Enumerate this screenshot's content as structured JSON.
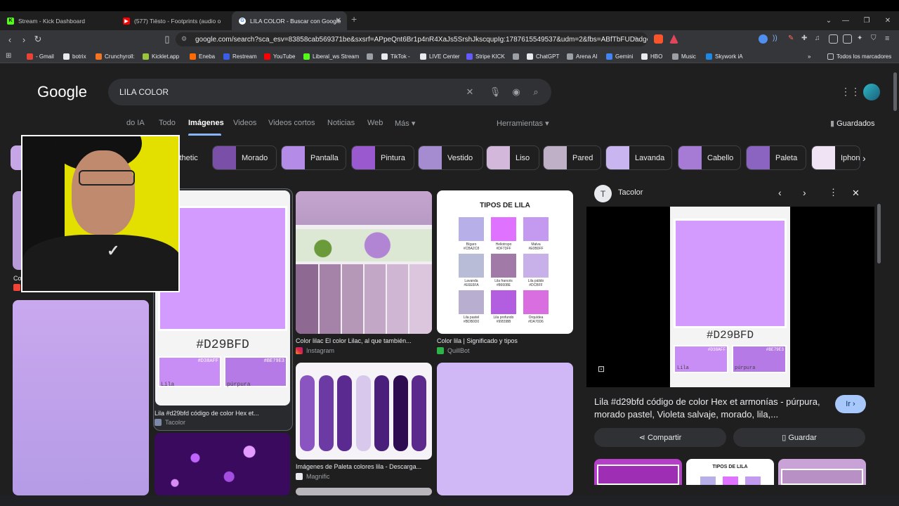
{
  "tabs": [
    {
      "title": "Stream - Kick Dashboard",
      "icon": "kick-icon",
      "color": "#53fc18"
    },
    {
      "title": "(577) Tiësto - Footprints (audio o",
      "icon": "youtube-icon",
      "color": "#ff0000"
    },
    {
      "title": "LILA COLOR - Buscar con Google",
      "icon": "google-icon",
      "color": "#ffffff"
    }
  ],
  "url": "google.com/search?sca_esv=83858cab569371be&sxsrf=APpeQnt6Br1p4nR4XaJs5SrshJkscqupIg:1787615549537&udm=2&fbs=ABfTbFUDadgeu2m...",
  "bookmarks": [
    {
      "label": "- Gmail",
      "color": "#ea4335"
    },
    {
      "label": "botrix",
      "color": "#e8eaed"
    },
    {
      "label": "Crunchyroll:",
      "color": "#f47521"
    },
    {
      "label": "Kicklet.app",
      "color": "#9ac53d"
    },
    {
      "label": "Eneba",
      "color": "#ff6b00"
    },
    {
      "label": "Restream",
      "color": "#3a5eea"
    },
    {
      "label": "YouTube",
      "color": "#ff0000"
    },
    {
      "label": "Liberal_ws Stream",
      "color": "#53fc18"
    },
    {
      "label": "",
      "color": "#9aa0a6"
    },
    {
      "label": "TikTok -",
      "color": "#e8eaed"
    },
    {
      "label": "LIVE Center",
      "color": "#e8eaed"
    },
    {
      "label": "Stripe KICK",
      "color": "#635bff"
    },
    {
      "label": "",
      "color": "#9aa0a6"
    },
    {
      "label": "ChatGPT",
      "color": "#e8eaed"
    },
    {
      "label": "Arena AI",
      "color": "#9aa0a6"
    },
    {
      "label": "Gemini",
      "color": "#4285f4"
    },
    {
      "label": "HBO",
      "color": "#e8eaed"
    },
    {
      "label": "Music",
      "color": "#9aa0a6"
    },
    {
      "label": "Skywork iA",
      "color": "#1e88e5"
    }
  ],
  "all_bookmarks": "Todos los marcadores",
  "google": {
    "logo": "Google",
    "query": "LILA COLOR"
  },
  "nav": {
    "modo_ia": "do IA",
    "todo": "Todo",
    "imagenes": "Imágenes",
    "videos": "Videos",
    "videos_cortos": "Videos cortos",
    "noticias": "Noticias",
    "web": "Web",
    "mas": "Más",
    "herramientas": "Herramientas",
    "guardados": "Guardados"
  },
  "chips": [
    {
      "label": "sthetic",
      "color": "#c7a6e8"
    },
    {
      "label": "Morado",
      "color": "#7a4fa8"
    },
    {
      "label": "Pantalla",
      "color": "#b48be6"
    },
    {
      "label": "Pintura",
      "color": "#9b59d0"
    },
    {
      "label": "Vestido",
      "color": "#a58bd0"
    },
    {
      "label": "Liso",
      "color": "#d4b8dc"
    },
    {
      "label": "Pared",
      "color": "#bfb0c8"
    },
    {
      "label": "Lavanda",
      "color": "#c9b6f0"
    },
    {
      "label": "Cabello",
      "color": "#a57bd5"
    },
    {
      "label": "Paleta",
      "color": "#8b63c0"
    },
    {
      "label": "Iphon",
      "color": "#f0e4f4"
    }
  ],
  "results": [
    {
      "caption": "Lila #d29bfd código de color Hex et...",
      "source": "Tacolor",
      "hex": "#D29BFD",
      "sub1": "#D38AFF",
      "sub2": "#BE79E3",
      "sub1label": "Lila",
      "sub2label": "púrpura"
    },
    {
      "caption": "Color lilac El color Lilac, al que también...",
      "source": "Instagram"
    },
    {
      "caption": "Color lila | Significado y tipos",
      "source": "QuillBot",
      "card_title": "TIPOS DE LILA",
      "swatches": [
        {
          "name": "Bígaro",
          "hex": "#CBA2C8",
          "color": "#b7b0e8"
        },
        {
          "name": "Heliotropo",
          "hex": "#DF73FF",
          "color": "#df73ff"
        },
        {
          "name": "Malva",
          "hex": "#E0B0FF",
          "color": "#c49af0"
        },
        {
          "name": "Lavanda",
          "hex": "#E6E6FA",
          "color": "#b8bcd6"
        },
        {
          "name": "Lila francés",
          "hex": "#86608E",
          "color": "#a27aa8"
        },
        {
          "name": "Lila pálido",
          "hex": "#DCBFF",
          "color": "#c8b0e8"
        },
        {
          "name": "Lila pastel",
          "hex": "#BDB0D0",
          "color": "#b8aed0"
        },
        {
          "name": "Lila profundo",
          "hex": "#9955BB",
          "color": "#b35ee0"
        },
        {
          "name": "Orquídea",
          "hex": "#DA70D6",
          "color": "#d86ee0"
        }
      ]
    },
    {
      "caption": "Imágenes de Paleta colores lila - Descarga...",
      "source": "Magnific"
    },
    {
      "caption": "Co",
      "source": ""
    }
  ],
  "panel": {
    "source": "Tacolor",
    "description": "Lila #d29bfd código de color Hex et armonías - púrpura, morado pastel, Violeta salvaje, morado, lila,...",
    "ir": "Ir",
    "compartir": "Compartir",
    "guardar": "Guardar",
    "hex": "#D29BFD",
    "sub1": "#D38AFF",
    "sub2": "#BE79E3",
    "sub1label": "Lila",
    "sub2label": "púrpura",
    "related_title": "TIPOS DE LILA"
  }
}
